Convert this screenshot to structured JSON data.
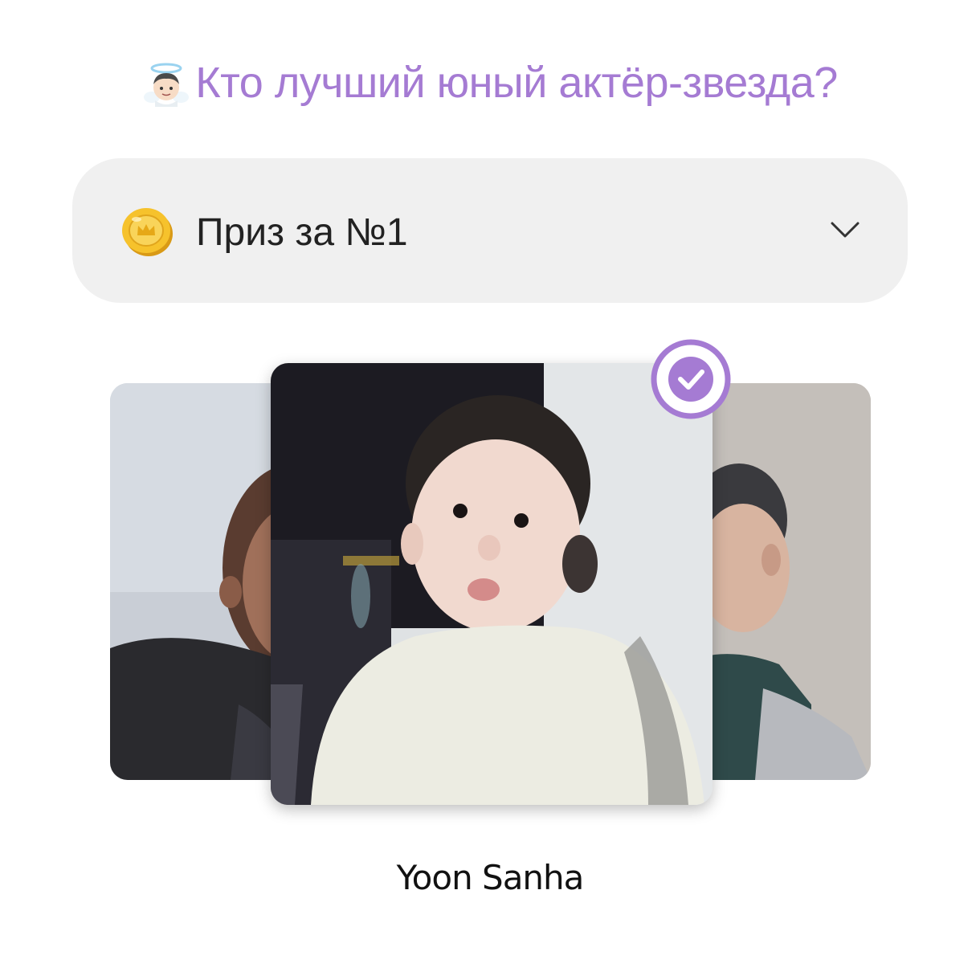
{
  "header": {
    "title": "Кто лучший юный актёр-звезда?",
    "title_icon": "angel-emoji-icon",
    "title_color": "#a57bd3"
  },
  "prize": {
    "label": "Приз за №1",
    "icon": "gold-coin-icon",
    "dropdown_icon": "chevron-down-icon",
    "background": "#f0f0f0"
  },
  "candidates": {
    "selected_name": "Yoon Sanha",
    "selected_icon": "check-circle-icon",
    "accent": "#a57bd3"
  }
}
